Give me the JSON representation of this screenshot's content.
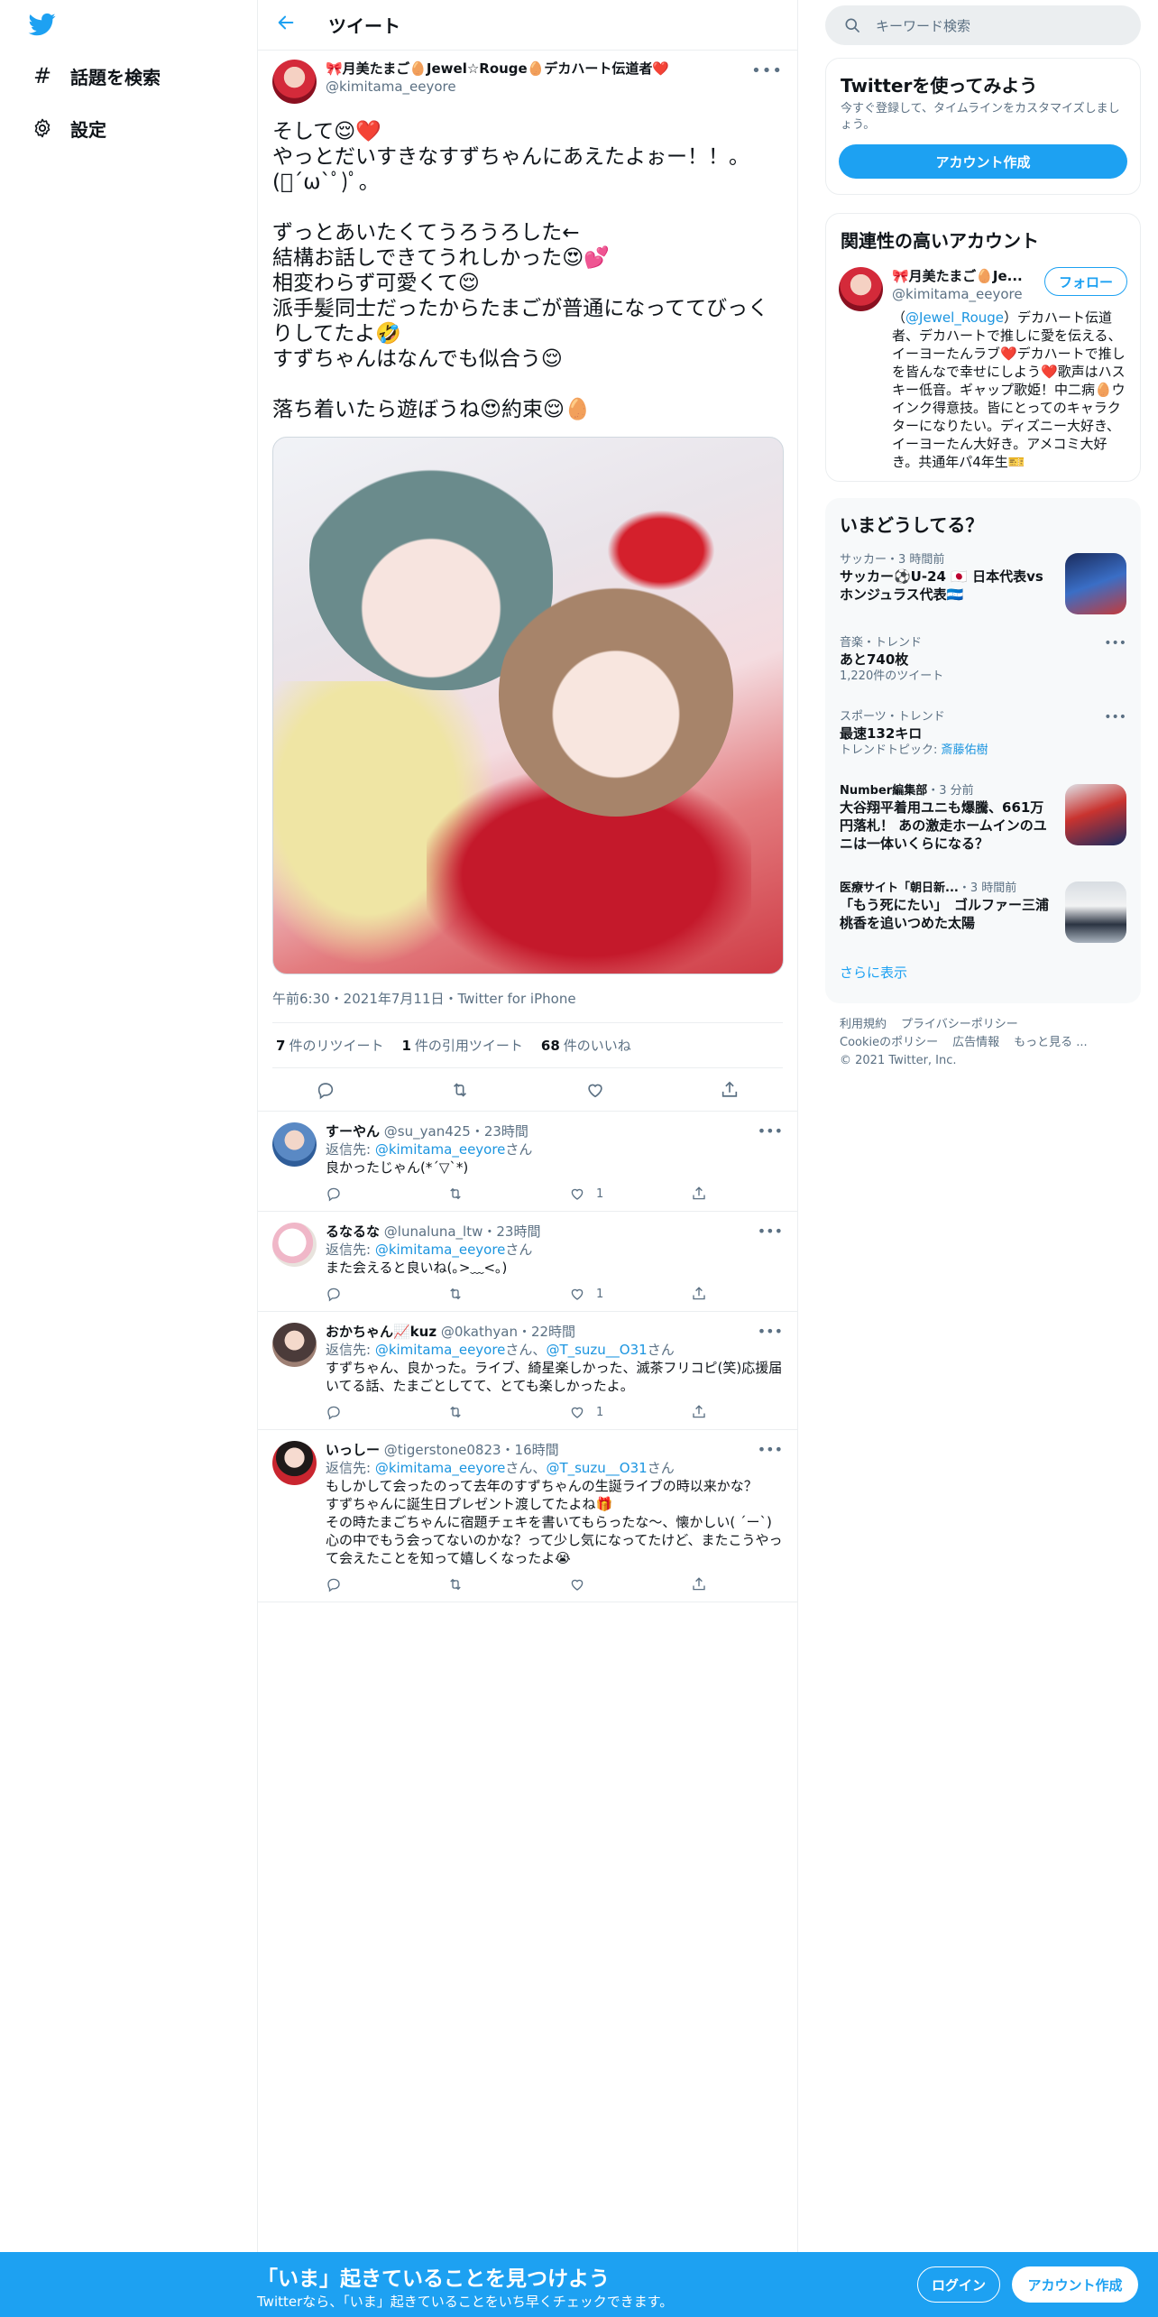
{
  "nav": {
    "items": [
      {
        "label": "話題を検索",
        "icon": "hashtag-icon"
      },
      {
        "label": "設定",
        "icon": "gear-icon"
      }
    ]
  },
  "header": {
    "title": "ツイート"
  },
  "tweet": {
    "display_name": "🎀月美たまご🥚Jewel☆Rouge🥚デカハート伝道者❤️",
    "handle": "@kimitama_eeyore",
    "text": "そして😌❤️\nやっとだいすきなすずちゃんにあえたよぉー！！。\n(ﾟ´ω`ﾟ)ﾟ。\n\nずっとあいたくてうろうろした←\n結構お話しできてうれしかった😍💕\n相変わらず可愛くて😌\n派手髪同士だったからたまごが普通になっててびっくりしてたよ🤣\nすずちゃんはなんでも似合う😌\n\n落ち着いたら遊ぼうね😍約束😌🥚",
    "meta": "午前6:30・2021年7月11日・Twitter for iPhone",
    "retweets": "7",
    "retweets_label": "件のリツイート",
    "quotes": "1",
    "quotes_label": "件の引用ツイート",
    "likes": "68",
    "likes_label": "件のいいね"
  },
  "replies": [
    {
      "name": "すーやん",
      "handle": "@su_yan425",
      "time": "・23時間",
      "reply_prefix": "返信先: ",
      "reply_to": "@kimitama_eeyore",
      "reply_suffix": "さん",
      "text": "良かったじゃん(*´▽`*)",
      "likes": "1"
    },
    {
      "name": "るなるな",
      "handle": "@lunaluna_ltw",
      "time": "・23時間",
      "reply_prefix": "返信先: ",
      "reply_to": "@kimitama_eeyore",
      "reply_suffix": "さん",
      "text": "また会えると良いね(｡>﹏<｡)",
      "likes": "1"
    },
    {
      "name": "おかちゃん📈kuz",
      "handle": "@0kathyan",
      "time": "・22時間",
      "reply_prefix": "返信先: ",
      "reply_to": "@kimitama_eeyore",
      "reply_mid": "さん、",
      "reply_to2": "@T_suzu__O31",
      "reply_suffix": "さん",
      "text": "すずちゃん、良かった。ライブ、綺星楽しかった、滅茶フリコピ(笑)応援届いてる話、たまごとしてて、とても楽しかったよ。",
      "likes": "1"
    },
    {
      "name": "いっしー",
      "handle": "@tigerstone0823",
      "time": "・16時間",
      "reply_prefix": "返信先: ",
      "reply_to": "@kimitama_eeyore",
      "reply_mid": "さん、",
      "reply_to2": "@T_suzu__O31",
      "reply_suffix": "さん",
      "text": "もしかして会ったのって去年のすずちゃんの生誕ライブの時以来かな？\nすずちゃんに誕生日プレゼント渡してたよね🎁\nその時たまごちゃんに宿題チェキを書いてもらったな～、懐かしい( ´ー`)\n心の中でもう会ってないのかな？って少し気になってたけど、またこうやって会えたことを知って嬉しくなったよ😭",
      "likes": ""
    }
  ],
  "right": {
    "search_placeholder": "キーワード検索",
    "signup_panel": {
      "title": "Twitterを使ってみよう",
      "subtitle": "今すぐ登録して、タイムラインをカスタマイズしましょう。",
      "button": "アカウント作成"
    },
    "related": {
      "title": "関連性の高いアカウント",
      "name": "🎀月美たまご🥚Je...",
      "handle": "@kimitama_eeyore",
      "follow": "フォロー",
      "bio_pre": "（",
      "bio_link": "@Jewel_Rouge",
      "bio_post": "）デカハート伝道者、デカハートで推しに愛を伝える、イーヨーたんラブ❤️デカハートで推しを皆んなで幸せにしよう❤️歌声はハスキー低音。ギャップ歌姫！中二病🥚ウインク得意技。皆にとってのキャラクターになりたい。ディズニー大好き、イーヨーたん大好き。アメコミ大好き。共通年パ4年生🎫"
    },
    "trends": {
      "title": "いまどうしてる？",
      "items": [
        {
          "meta": "サッカー・3 時間前",
          "title": "サッカー⚽U-24 🇯🇵 日本代表vsホンジュラス代表🇭🇳",
          "sub": ""
        },
        {
          "meta": "音楽・トレンド",
          "title": "あと740枚",
          "sub": "1,220件のツイート"
        },
        {
          "meta": "スポーツ・トレンド",
          "title": "最速132キロ",
          "sub_prefix": "トレンドトピック: ",
          "sub_link": "斎藤佑樹"
        },
        {
          "meta_name": "Number編集部",
          "meta_time": "・3 分前",
          "title": "大谷翔平着用ユニも爆騰、661万円落札！ あの激走ホームインのユニは一体いくらになる？"
        },
        {
          "meta_name": "医療サイト「朝日新...",
          "meta_time": "・3 時間前",
          "title": "「もう死にたい」　ゴルファー三浦桃香を追いつめた太陽"
        }
      ],
      "more": "さらに表示"
    },
    "footer": {
      "links": [
        "利用規約",
        "プライバシーポリシー",
        "Cookieのポリシー",
        "広告情報",
        "もっと見る ..."
      ],
      "copyright": "© 2021 Twitter, Inc."
    }
  },
  "bottom": {
    "title": "「いま」起きていることを見つけよう",
    "subtitle": "Twitterなら、「いま」起きていることをいち早くチェックできます。",
    "login": "ログイン",
    "signup": "アカウント作成"
  }
}
